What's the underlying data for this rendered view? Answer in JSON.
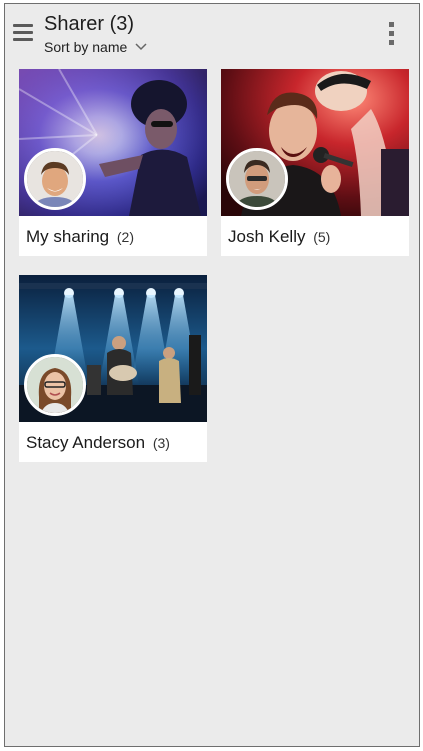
{
  "header": {
    "title": "Sharer (3)",
    "sort_label": "Sort by name"
  },
  "icons": {
    "menu": "hamburger-menu-icon",
    "sort": "chevron-down-icon",
    "overflow": "vertical-dots-icon"
  },
  "sharers": [
    {
      "name": "My sharing",
      "count": "(2)"
    },
    {
      "name": "Josh Kelly",
      "count": "(5)"
    },
    {
      "name": "Stacy Anderson",
      "count": "(3)"
    }
  ],
  "colors": {
    "background": "#ebebeb",
    "card": "#ffffff",
    "text": "#1b1b1b"
  }
}
